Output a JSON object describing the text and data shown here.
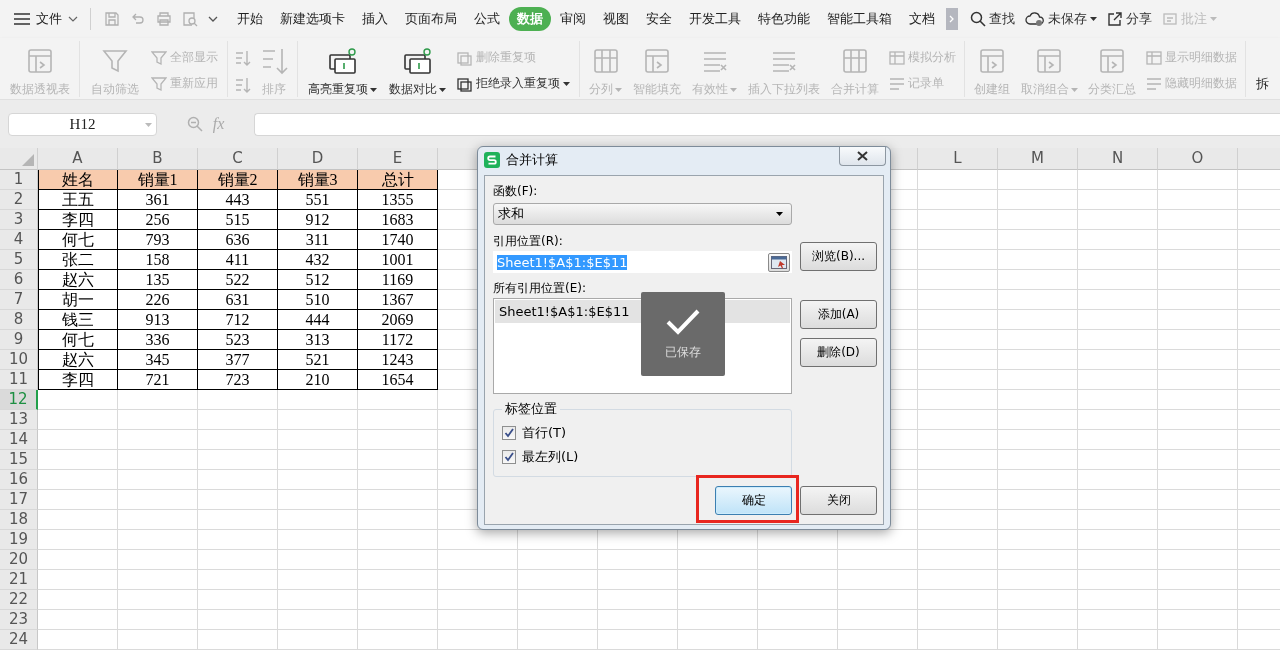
{
  "app_menu": {
    "label": "文件"
  },
  "tabs": [
    {
      "label": "开始",
      "selected": false
    },
    {
      "label": "新建选项卡",
      "selected": false
    },
    {
      "label": "插入",
      "selected": false
    },
    {
      "label": "页面布局",
      "selected": false
    },
    {
      "label": "公式",
      "selected": false
    },
    {
      "label": "数据",
      "selected": true
    },
    {
      "label": "审阅",
      "selected": false
    },
    {
      "label": "视图",
      "selected": false
    },
    {
      "label": "安全",
      "selected": false
    },
    {
      "label": "开发工具",
      "selected": false
    },
    {
      "label": "特色功能",
      "selected": false
    },
    {
      "label": "智能工具箱",
      "selected": false
    },
    {
      "label": "文档",
      "selected": false
    }
  ],
  "toolbar_right": [
    {
      "label": "查找",
      "disabled": false,
      "dropdown": false
    },
    {
      "label": "未保存",
      "disabled": false,
      "dropdown": true
    },
    {
      "label": "分享",
      "disabled": false,
      "dropdown": false
    },
    {
      "label": "批注",
      "disabled": true,
      "dropdown": true
    }
  ],
  "ribbon": [
    {
      "items": [
        {
          "label": "数据透视表",
          "kind": "large",
          "disabled": true,
          "dropdown": false
        }
      ]
    },
    {
      "items": [
        {
          "label": "自动筛选",
          "kind": "large",
          "disabled": true,
          "dropdown": false
        },
        {
          "label": "全部显示",
          "kind": "small",
          "disabled": true,
          "dropdown": false
        },
        {
          "label": "重新应用",
          "kind": "small",
          "disabled": true,
          "dropdown": false
        }
      ]
    },
    {
      "items": [
        {
          "kind": "sort-pair",
          "disabled": true
        },
        {
          "label": "排序",
          "kind": "large",
          "disabled": true,
          "dropdown": false
        }
      ]
    },
    {
      "items": [
        {
          "label": "高亮重复项",
          "kind": "large",
          "disabled": false,
          "dropdown": true
        },
        {
          "label": "数据对比",
          "kind": "large",
          "disabled": false,
          "dropdown": true
        },
        {
          "label": "删除重复项",
          "kind": "small",
          "disabled": true,
          "dropdown": false
        },
        {
          "label": "拒绝录入重复项",
          "kind": "small",
          "disabled": false,
          "dropdown": true
        }
      ]
    },
    {
      "items": [
        {
          "label": "分列",
          "kind": "large",
          "disabled": true,
          "dropdown": true
        },
        {
          "label": "智能填充",
          "kind": "large",
          "disabled": true,
          "dropdown": false
        },
        {
          "label": "有效性",
          "kind": "large",
          "disabled": true,
          "dropdown": true
        },
        {
          "label": "插入下拉列表",
          "kind": "large",
          "disabled": true,
          "dropdown": false
        },
        {
          "label": "合并计算",
          "kind": "large",
          "disabled": true,
          "dropdown": false
        },
        {
          "label": "模拟分析",
          "kind": "small",
          "disabled": true,
          "dropdown": false
        },
        {
          "label": "记录单",
          "kind": "small",
          "disabled": true,
          "dropdown": false
        }
      ]
    },
    {
      "items": [
        {
          "label": "创建组",
          "kind": "large",
          "disabled": true,
          "dropdown": false
        },
        {
          "label": "取消组合",
          "kind": "large",
          "disabled": true,
          "dropdown": true
        },
        {
          "label": "分类汇总",
          "kind": "large",
          "disabled": true,
          "dropdown": false
        },
        {
          "label": "显示明细数据",
          "kind": "small",
          "disabled": true,
          "dropdown": false
        },
        {
          "label": "隐藏明细数据",
          "kind": "small",
          "disabled": true,
          "dropdown": false
        }
      ]
    },
    {
      "items": [
        {
          "label": "拆",
          "kind": "text"
        }
      ]
    }
  ],
  "formula_bar": {
    "name_box": "H12",
    "fx": "fx"
  },
  "sheet": {
    "columns_left": [
      "A",
      "B",
      "C",
      "D",
      "E"
    ],
    "columns_right": [
      "L",
      "M",
      "N",
      "O"
    ],
    "rows": [
      {
        "label": "1",
        "selected": false
      },
      {
        "label": "2",
        "selected": false
      },
      {
        "label": "3",
        "selected": false
      },
      {
        "label": "4",
        "selected": false
      },
      {
        "label": "5",
        "selected": false
      },
      {
        "label": "6",
        "selected": false
      },
      {
        "label": "7",
        "selected": false
      },
      {
        "label": "8",
        "selected": false
      },
      {
        "label": "9",
        "selected": false
      },
      {
        "label": "10",
        "selected": false
      },
      {
        "label": "11",
        "selected": false
      },
      {
        "label": "12",
        "selected": true
      },
      {
        "label": "13",
        "selected": false
      },
      {
        "label": "14",
        "selected": false
      },
      {
        "label": "15",
        "selected": false
      },
      {
        "label": "16",
        "selected": false
      },
      {
        "label": "17",
        "selected": false
      },
      {
        "label": "18",
        "selected": false
      },
      {
        "label": "19",
        "selected": false
      },
      {
        "label": "20",
        "selected": false
      },
      {
        "label": "21",
        "selected": false
      },
      {
        "label": "22",
        "selected": false
      },
      {
        "label": "23",
        "selected": false
      },
      {
        "label": "24",
        "selected": false
      }
    ],
    "table": {
      "header": [
        "姓名",
        "销量1",
        "销量2",
        "销量3",
        "总计"
      ],
      "rows": [
        [
          "王五",
          "361",
          "443",
          "551",
          "1355"
        ],
        [
          "李四",
          "256",
          "515",
          "912",
          "1683"
        ],
        [
          "何七",
          "793",
          "636",
          "311",
          "1740"
        ],
        [
          "张二",
          "158",
          "411",
          "432",
          "1001"
        ],
        [
          "赵六",
          "135",
          "522",
          "512",
          "1169"
        ],
        [
          "胡一",
          "226",
          "631",
          "510",
          "1367"
        ],
        [
          "钱三",
          "913",
          "712",
          "444",
          "2069"
        ],
        [
          "何七",
          "336",
          "523",
          "313",
          "1172"
        ],
        [
          "赵六",
          "345",
          "377",
          "521",
          "1243"
        ],
        [
          "李四",
          "721",
          "723",
          "210",
          "1654"
        ]
      ]
    }
  },
  "dialog": {
    "title": "合并计算",
    "function_label": "函数(F):",
    "function_value": "求和",
    "reference_label": "引用位置(R):",
    "reference_value": "Sheet1!$A$1:$E$11",
    "reference_selected": true,
    "browse_button": "浏览(B)...",
    "all_references_label": "所有引用位置(E):",
    "all_references": [
      {
        "text": "Sheet1!$A$1:$E$11",
        "selected": true
      }
    ],
    "add_button": "添加(A)",
    "delete_button": "删除(D)",
    "label_group": "标签位置",
    "checkboxes": [
      {
        "label": "首行(T)",
        "checked": true
      },
      {
        "label": "最左列(L)",
        "checked": true
      }
    ],
    "ok_button": {
      "label": "确定",
      "focused": true,
      "highlighted": true
    },
    "close_button": "关闭"
  },
  "toast": {
    "label": "已保存"
  }
}
